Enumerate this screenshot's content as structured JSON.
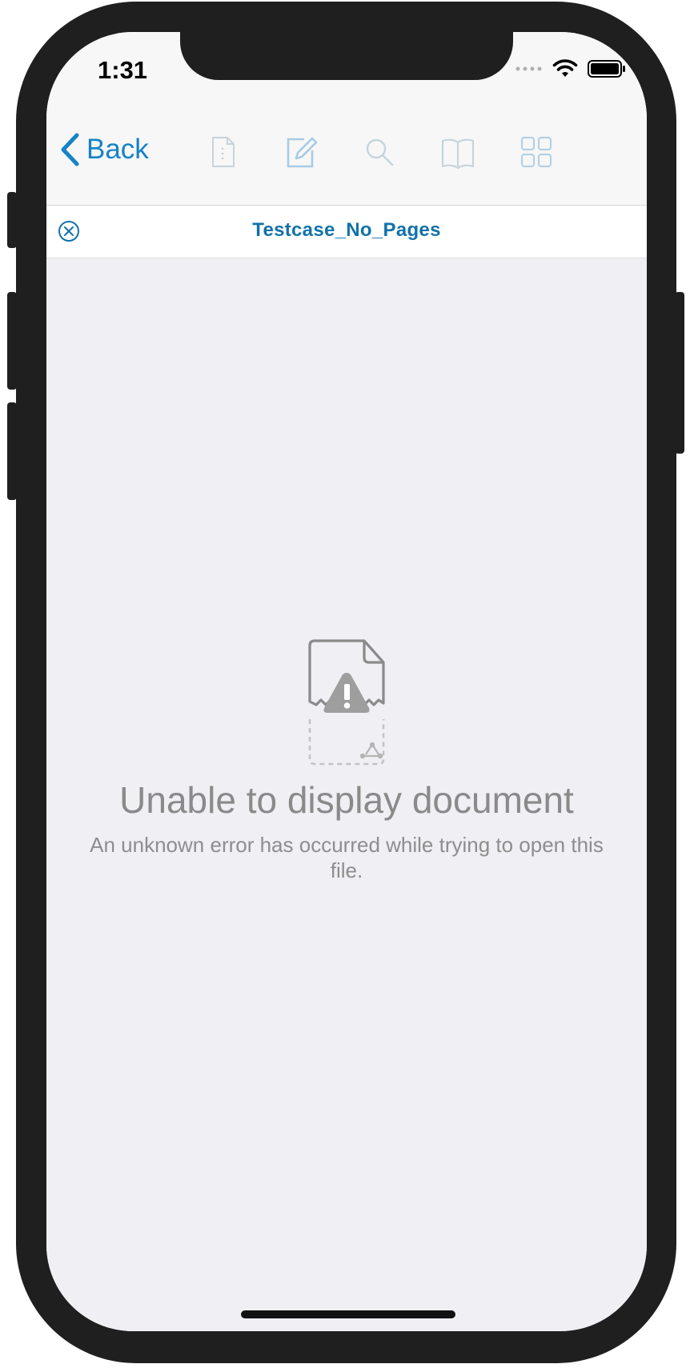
{
  "status_bar": {
    "time": "1:31",
    "icons": [
      "cellular-dots-icon",
      "wifi-icon",
      "battery-icon"
    ]
  },
  "nav_bar": {
    "back_label": "Back",
    "tools": [
      "document-info-icon",
      "annotate-icon",
      "search-icon",
      "outline-icon",
      "thumbnails-icon"
    ]
  },
  "document": {
    "title": "Testcase_No_Pages"
  },
  "error": {
    "title": "Unable to display document",
    "message": "An unknown error has occurred while trying to open this file."
  },
  "colors": {
    "accent": "#1683c6",
    "title": "#1272aa",
    "background": "#efeff4",
    "bar": "#f7f7f7",
    "muted_text": "#8a8a8a",
    "device": "#1f1f1f"
  }
}
